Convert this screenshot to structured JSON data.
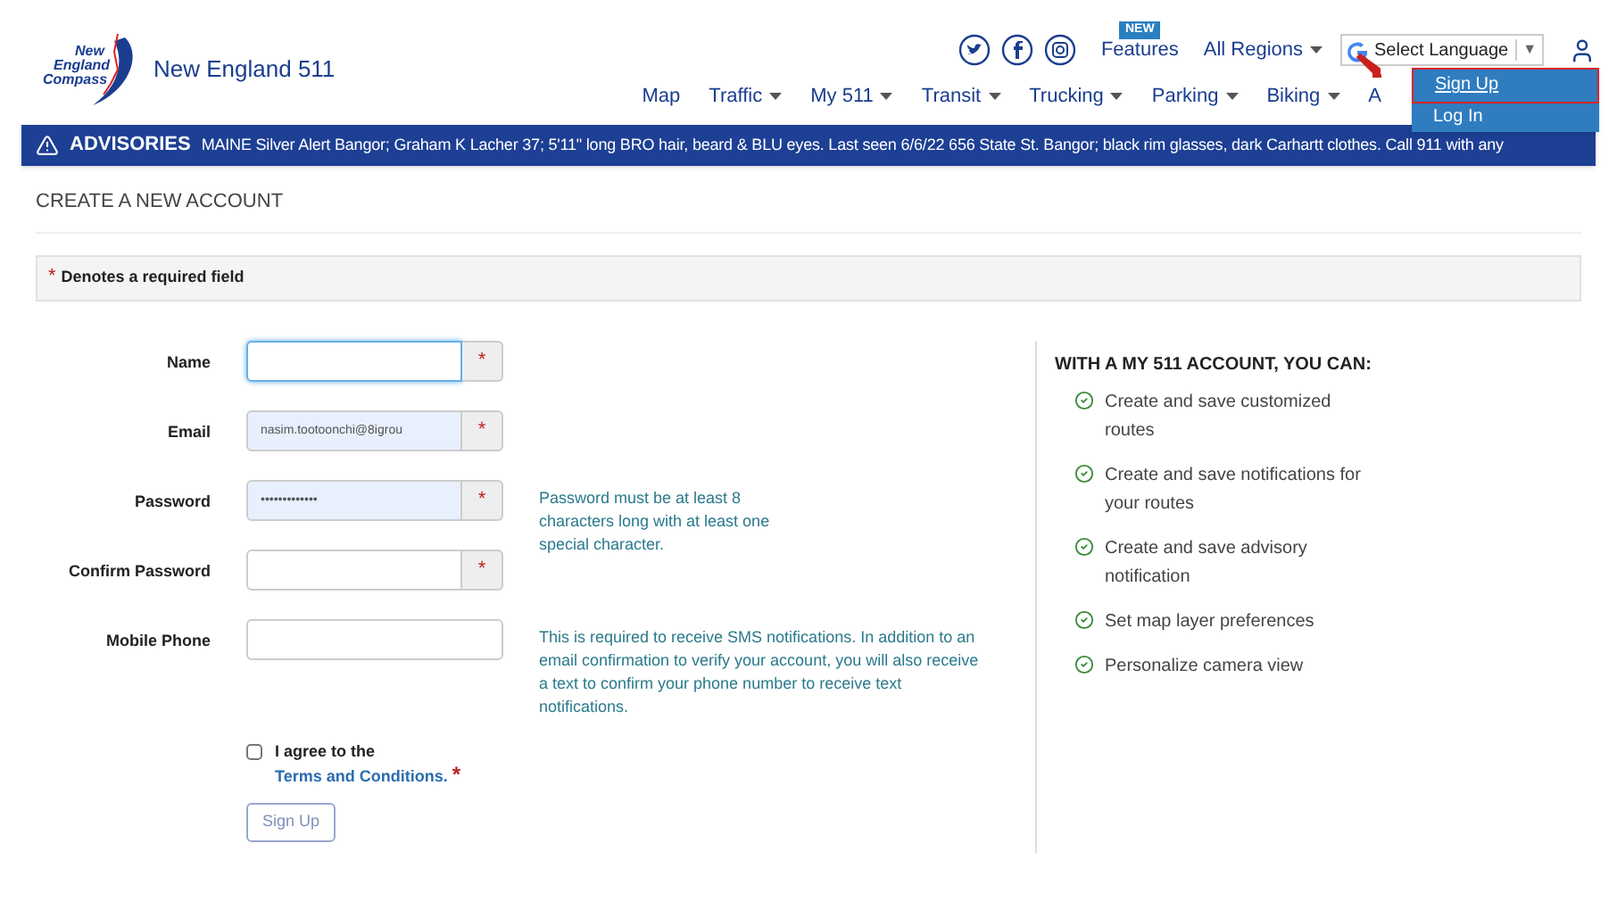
{
  "brand": {
    "logo_text": [
      "New",
      "England",
      "Compass"
    ],
    "name": "New England 511"
  },
  "top_links": {
    "new_badge": "NEW",
    "features": "Features",
    "regions": "All Regions",
    "language": "Select Language",
    "language_arrow": "▼"
  },
  "nav": [
    {
      "label": "Map",
      "caret": false
    },
    {
      "label": "Traffic",
      "caret": true
    },
    {
      "label": "My 511",
      "caret": true
    },
    {
      "label": "Transit",
      "caret": true
    },
    {
      "label": "Trucking",
      "caret": true
    },
    {
      "label": "Parking",
      "caret": true
    },
    {
      "label": "Biking",
      "caret": true
    },
    {
      "label": "A",
      "caret": false
    }
  ],
  "account_menu": [
    {
      "label": "Sign Up",
      "selected": true
    },
    {
      "label": "Log In",
      "selected": false
    }
  ],
  "advisory": {
    "label": "ADVISORIES",
    "text": "MAINE Silver Alert Bangor; Graham K Lacher 37; 5'11\" long BRO hair, beard & BLU eyes. Last seen 6/6/22 656 State St. Bangor; black rim glasses, dark Carhartt clothes. Call 911 with any"
  },
  "page_title": "CREATE A NEW ACCOUNT",
  "required_note": {
    "mark": "*",
    "text": "Denotes a required field"
  },
  "fields": [
    {
      "label": "Name",
      "required": true,
      "focused": true,
      "autofilled": false
    },
    {
      "label": "Email",
      "value": "nasim.tootoonchi@8igrou",
      "required": true,
      "focused": false,
      "autofilled": true
    },
    {
      "label": "Password",
      "value": "•••••••••••••",
      "required": true,
      "focused": false,
      "autofilled": true,
      "help": "Password must be at least 8 characters long with at least one special character."
    },
    {
      "label": "Confirm Password",
      "required": true,
      "focused": false,
      "autofilled": false
    },
    {
      "label": "Mobile Phone",
      "required": false,
      "focused": false,
      "autofilled": false,
      "help": "This is required to receive SMS notifications. In addition to an email confirmation to verify your account, you will also receive a text to confirm your phone number to receive text notifications."
    }
  ],
  "agree": {
    "checked": false,
    "text": "I agree to the",
    "link": "Terms and Conditions",
    "suffix": ".",
    "mark": "*"
  },
  "submit": "Sign Up",
  "benefits": {
    "title": "WITH A MY 511 ACCOUNT, YOU CAN:",
    "items": [
      "Create and save customized routes",
      "Create and save notifications for your routes",
      "Create and save advisory notification",
      "Set map layer preferences",
      "Personalize camera view"
    ]
  }
}
